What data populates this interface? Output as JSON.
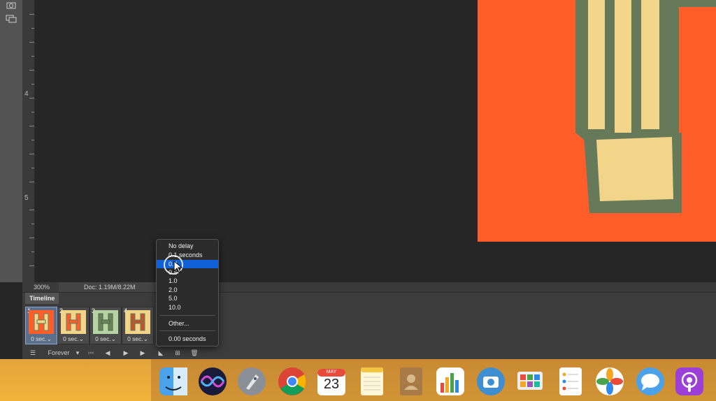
{
  "status": {
    "zoom": "300%",
    "doc": "Doc: 1.19M/8.22M"
  },
  "ruler": {
    "marks": [
      "4",
      "5"
    ]
  },
  "timeline": {
    "tab_label": "Timeline",
    "frames": [
      {
        "index": "1",
        "delay": "0 sec.⌄",
        "letter": "H",
        "bg": "#ff5e2a",
        "fg": "#f3d58a",
        "selected": true
      },
      {
        "index": "2",
        "delay": "0 sec.⌄",
        "letter": "H",
        "bg": "#f3d58a",
        "fg": "#ff5e2a",
        "selected": false
      },
      {
        "index": "3",
        "delay": "0 sec.⌄",
        "letter": "H",
        "bg": "#b6d3a3",
        "fg": "#67845a",
        "selected": false
      },
      {
        "index": "4",
        "delay": "0 sec.⌄",
        "letter": "H",
        "bg": "#f3d58a",
        "fg": "#c0552c",
        "selected": false
      }
    ],
    "loop": "Forever"
  },
  "delay_menu": {
    "items": [
      "No delay",
      "0.1 seconds",
      "0.2",
      "0.5",
      "1.0",
      "2.0",
      "5.0",
      "10.0"
    ],
    "selected": "0.2",
    "other": "Other...",
    "current": "0.00 seconds"
  },
  "dock": {
    "calendar_month": "MAY",
    "calendar_day": "23",
    "apps": [
      "finder",
      "siri",
      "launchpad",
      "chrome",
      "calendar",
      "notes",
      "contacts",
      "numbers",
      "image-capture",
      "keynote",
      "reminders",
      "photos",
      "messages",
      "podcasts"
    ]
  },
  "colors": {
    "canvas": "#ff5e2a",
    "pencil_body": "#f3d58a",
    "pencil_outline": "#667a5a",
    "selection": "#1060d8"
  }
}
